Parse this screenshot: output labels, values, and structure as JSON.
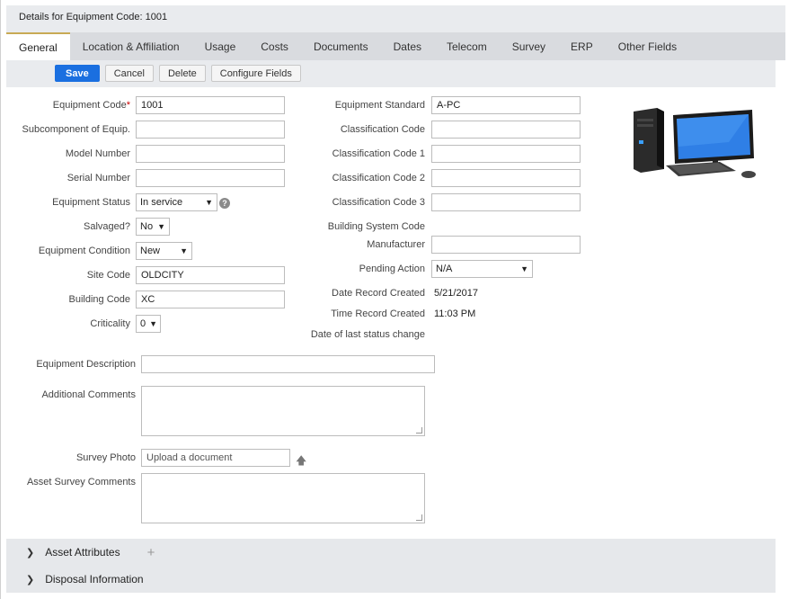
{
  "window": {
    "title": "Details for Equipment Code: 1001"
  },
  "tabs": [
    {
      "label": "General"
    },
    {
      "label": "Location & Affiliation"
    },
    {
      "label": "Usage"
    },
    {
      "label": "Costs"
    },
    {
      "label": "Documents"
    },
    {
      "label": "Dates"
    },
    {
      "label": "Telecom"
    },
    {
      "label": "Survey"
    },
    {
      "label": "ERP"
    },
    {
      "label": "Other Fields"
    }
  ],
  "toolbar": {
    "save": "Save",
    "cancel": "Cancel",
    "delete": "Delete",
    "configure": "Configure Fields"
  },
  "left": {
    "equipment_code": {
      "label": "Equipment Code",
      "required_mark": "*",
      "value": "1001"
    },
    "subcomponent": {
      "label": "Subcomponent of Equip.",
      "value": ""
    },
    "model_number": {
      "label": "Model Number",
      "value": ""
    },
    "serial_number": {
      "label": "Serial Number",
      "value": ""
    },
    "equipment_status": {
      "label": "Equipment Status",
      "value": "In service"
    },
    "salvaged": {
      "label": "Salvaged?",
      "value": "No"
    },
    "equipment_condition": {
      "label": "Equipment Condition",
      "value": "New"
    },
    "site_code": {
      "label": "Site Code",
      "value": "OLDCITY"
    },
    "building_code": {
      "label": "Building Code",
      "value": "XC"
    },
    "criticality": {
      "label": "Criticality",
      "value": "0"
    }
  },
  "right": {
    "equipment_standard": {
      "label": "Equipment Standard",
      "value": "A-PC"
    },
    "classification_code": {
      "label": "Classification Code",
      "value": ""
    },
    "classification_code_1": {
      "label": "Classification Code 1",
      "value": ""
    },
    "classification_code_2": {
      "label": "Classification Code 2",
      "value": ""
    },
    "classification_code_3": {
      "label": "Classification Code 3",
      "value": ""
    },
    "building_system_code": {
      "label": "Building System Code"
    },
    "manufacturer": {
      "label": "Manufacturer",
      "value": ""
    },
    "pending_action": {
      "label": "Pending Action",
      "value": "N/A"
    },
    "date_record_created": {
      "label": "Date Record Created",
      "value": "5/21/2017"
    },
    "time_record_created": {
      "label": "Time Record Created",
      "value": "11:03 PM"
    },
    "date_last_status_change": {
      "label": "Date of last status change"
    }
  },
  "bottom": {
    "equipment_description": {
      "label": "Equipment Description",
      "value": ""
    },
    "additional_comments": {
      "label": "Additional Comments"
    },
    "survey_photo": {
      "label": "Survey Photo",
      "placeholder": "Upload a document"
    },
    "asset_survey_comments": {
      "label": "Asset Survey Comments"
    }
  },
  "panels": {
    "asset_attributes": "Asset Attributes",
    "disposal_information": "Disposal Information"
  },
  "icons": {
    "help": "question-icon",
    "upload": "upload-arrow-icon",
    "chevron": "chevron-right-icon",
    "plus": "plus-icon"
  },
  "colors": {
    "primary": "#1a6fe0",
    "active_tab_accent": "#c8aa55",
    "required": "#cc0000"
  }
}
